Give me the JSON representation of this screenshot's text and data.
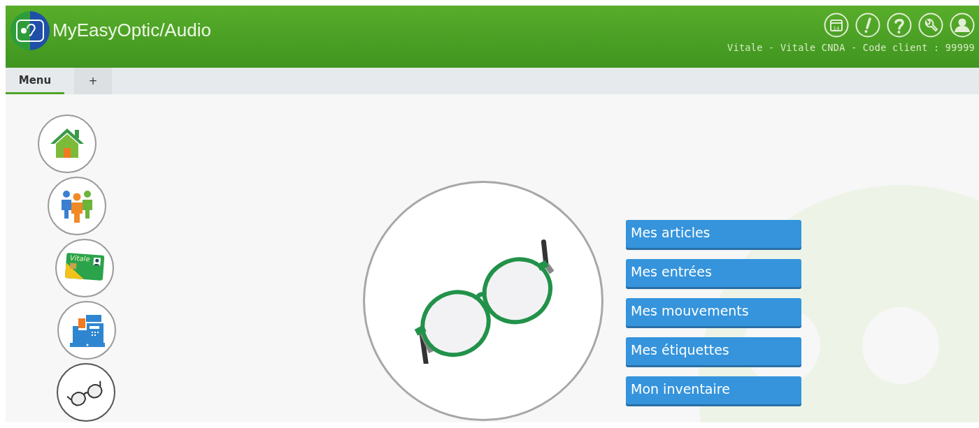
{
  "app": {
    "title": "MyEasyOptic/Audio"
  },
  "header": {
    "icons": [
      {
        "kind": "calendar",
        "label": "14"
      },
      {
        "kind": "alert"
      },
      {
        "kind": "help"
      },
      {
        "kind": "tools"
      },
      {
        "kind": "user"
      }
    ],
    "info": "Vitale - Vitale CNDA - Code client : 99999"
  },
  "tabs": [
    {
      "label": "Menu",
      "selected": true
    },
    {
      "label": "+",
      "selected": false
    }
  ],
  "sidebar": {
    "items": [
      {
        "kind": "home",
        "selected": false
      },
      {
        "kind": "people",
        "selected": false
      },
      {
        "kind": "card",
        "label": "Vitale",
        "selected": false
      },
      {
        "kind": "register",
        "selected": false
      },
      {
        "kind": "glasses",
        "selected": true
      }
    ]
  },
  "panel": {
    "buttons": [
      "Mes articles",
      "Mes entrées",
      "Mes mouvements",
      "Mes étiquettes",
      "Mon inventaire"
    ]
  }
}
